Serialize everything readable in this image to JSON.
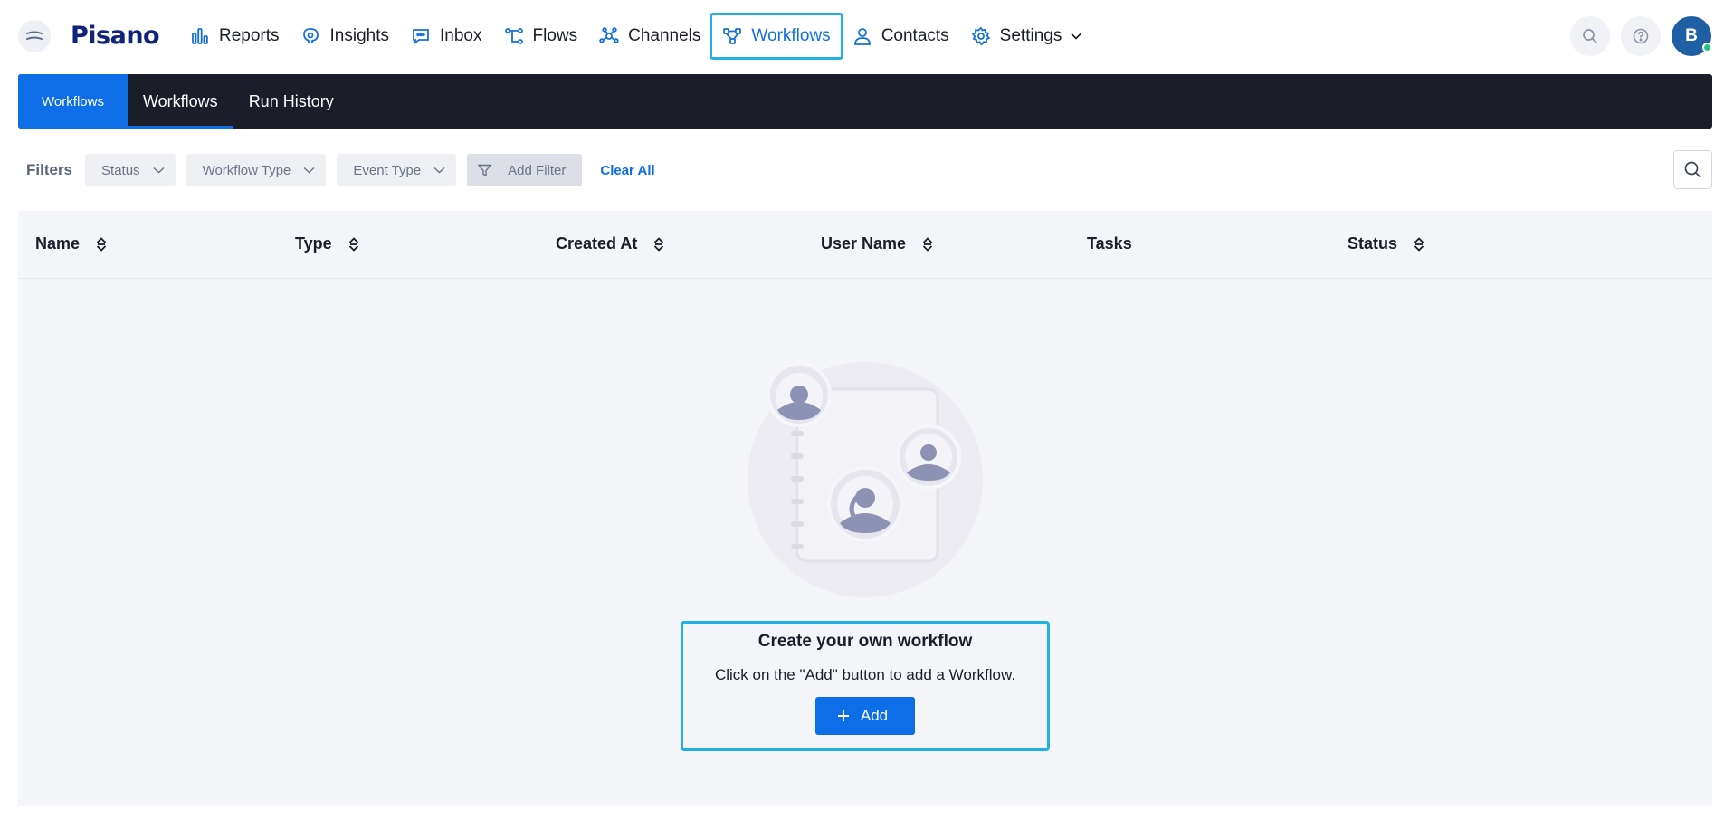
{
  "brand": {
    "logo": "Pisano"
  },
  "nav": {
    "items": [
      {
        "label": "Reports",
        "icon": "bar-chart-icon"
      },
      {
        "label": "Insights",
        "icon": "brain-icon"
      },
      {
        "label": "Inbox",
        "icon": "chat-icon"
      },
      {
        "label": "Flows",
        "icon": "flows-icon"
      },
      {
        "label": "Channels",
        "icon": "channels-icon"
      },
      {
        "label": "Workflows",
        "icon": "workflow-icon",
        "active": true
      },
      {
        "label": "Contacts",
        "icon": "person-icon"
      },
      {
        "label": "Settings",
        "icon": "gear-icon"
      }
    ]
  },
  "user": {
    "initial": "B",
    "status": "online"
  },
  "subheader": {
    "title": "Workflows",
    "tabs": [
      {
        "label": "Workflows",
        "active": true
      },
      {
        "label": "Run History",
        "active": false
      }
    ]
  },
  "filters": {
    "label": "Filters",
    "dropdowns": [
      "Status",
      "Workflow Type",
      "Event Type"
    ],
    "add_filter": "Add Filter",
    "clear_all": "Clear All"
  },
  "table": {
    "columns": [
      {
        "label": "Name",
        "sortable": true
      },
      {
        "label": "Type",
        "sortable": true
      },
      {
        "label": "Created At",
        "sortable": true
      },
      {
        "label": "User Name",
        "sortable": true
      },
      {
        "label": "Tasks",
        "sortable": false
      },
      {
        "label": "Status",
        "sortable": true
      }
    ],
    "rows": []
  },
  "empty_state": {
    "title": "Create your own workflow",
    "text": "Click on the \"Add\" button to add a Workflow.",
    "button": "Add"
  },
  "colors": {
    "accent": "#0d6ee8",
    "highlight": "#22aee6",
    "dark_bar": "#1b1d29",
    "table_bg": "#f4f5f8"
  }
}
